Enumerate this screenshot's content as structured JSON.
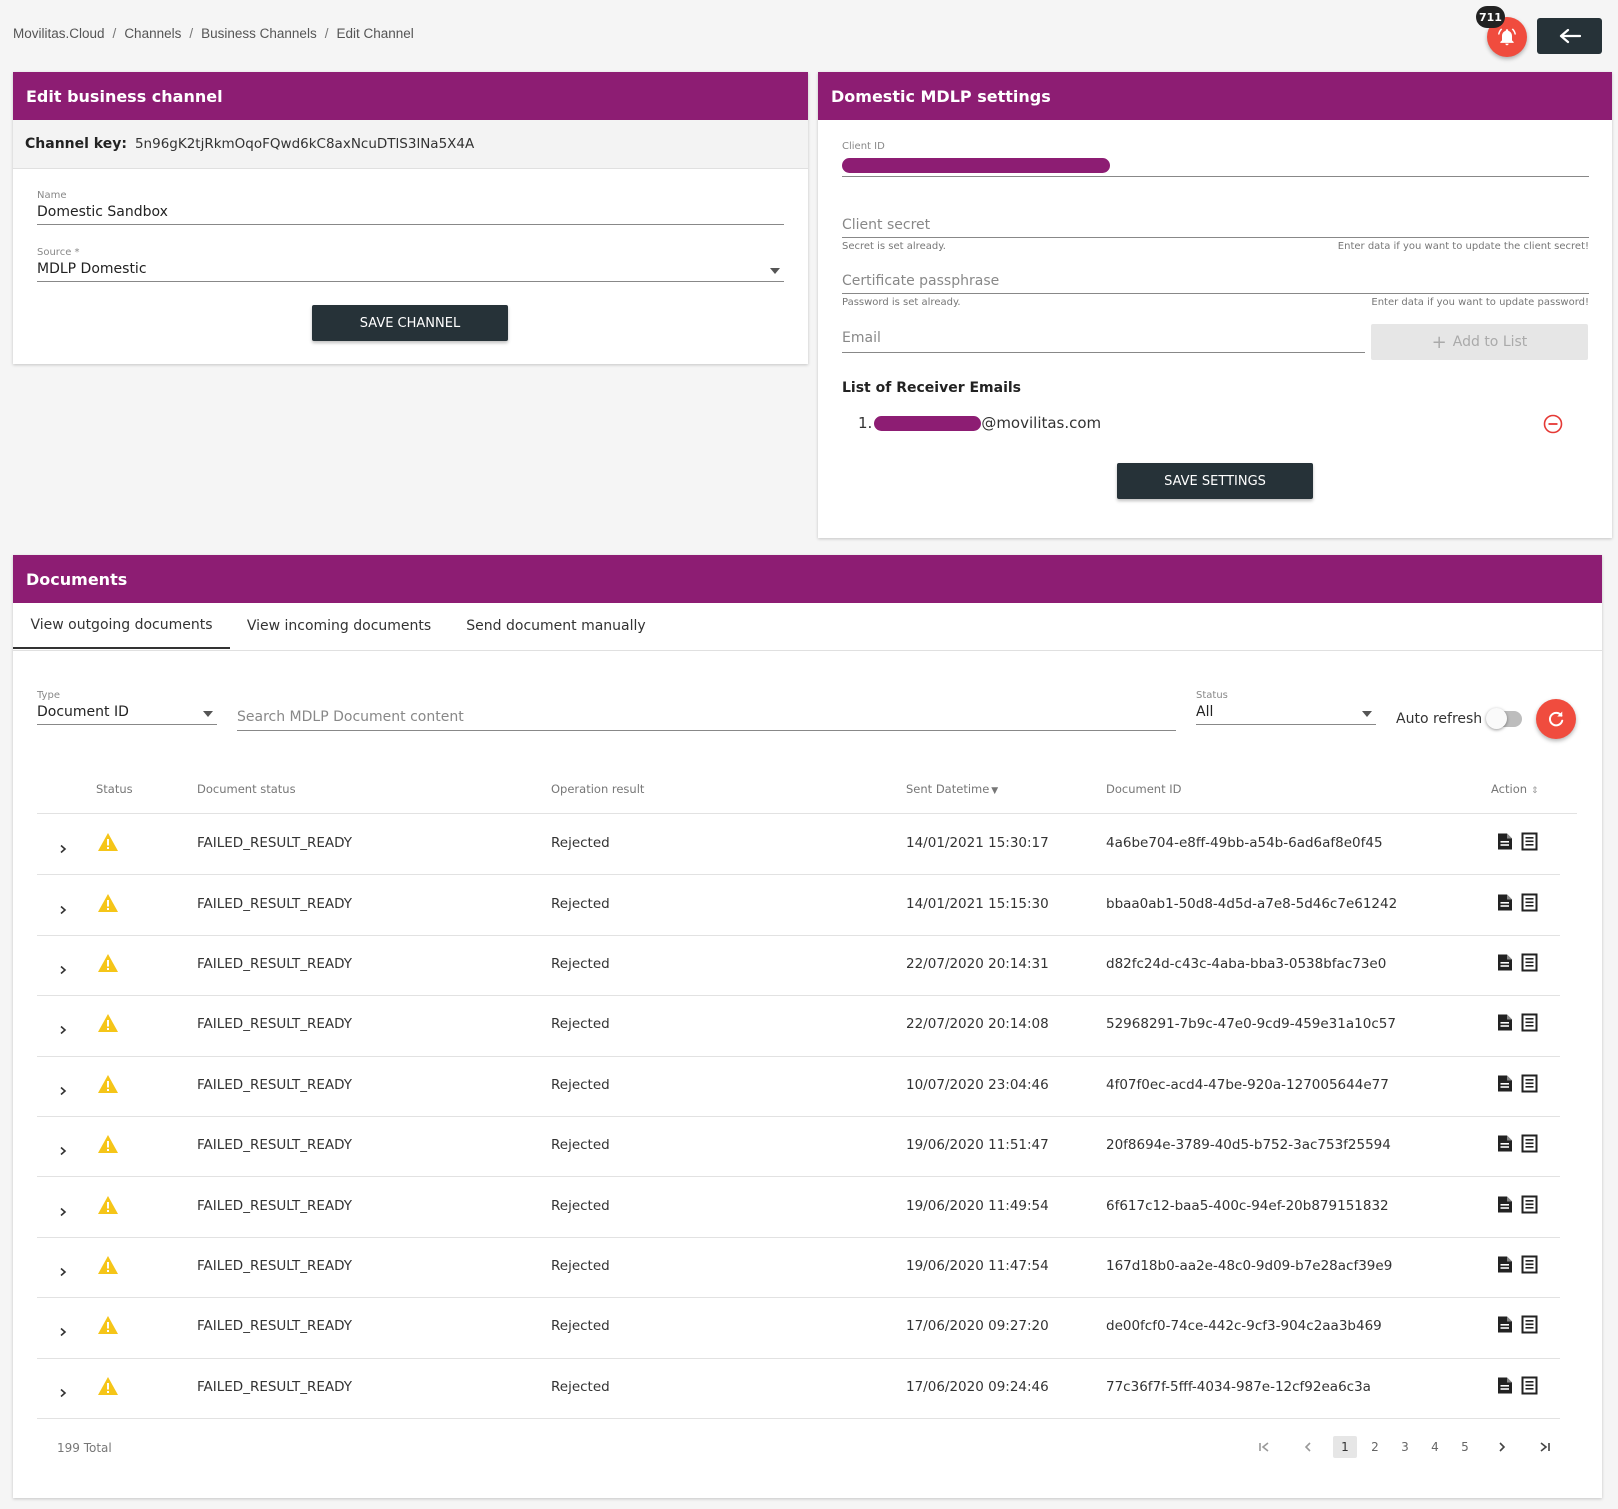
{
  "breadcrumb": [
    "Movilitas.Cloud",
    "Channels",
    "Business Channels",
    "Edit Channel"
  ],
  "notifications": {
    "count": "711"
  },
  "edit_channel": {
    "title": "Edit business channel",
    "channel_key_label": "Channel key:",
    "channel_key": "5n96gK2tjRkmOqoFQwd6kC8axNcuDTlS3lNa5X4A",
    "name_label": "Name",
    "name_value": "Domestic Sandbox",
    "source_label": "Source *",
    "source_value": "MDLP Domestic",
    "save_label": "SAVE CHANNEL"
  },
  "mdlp_settings": {
    "title": "Domestic MDLP settings",
    "client_id_label": "Client ID",
    "client_secret_placeholder": "Client secret",
    "secret_hint_left": "Secret is set already.",
    "secret_hint_right": "Enter data if you want to update the client secret!",
    "cert_placeholder": "Certificate passphrase",
    "cert_hint_left": "Password is set already.",
    "cert_hint_right": "Enter data if you want to update password!",
    "email_placeholder": "Email",
    "add_label": "Add to List",
    "receivers_title": "List of Receiver Emails",
    "receivers": [
      {
        "index": "1.",
        "domain": "@movilitas.com"
      }
    ],
    "save_label": "SAVE SETTINGS"
  },
  "documents": {
    "title": "Documents",
    "tabs": [
      "View outgoing documents",
      "View incoming documents",
      "Send document manually"
    ],
    "filters": {
      "type_label": "Type",
      "type_value": "Document ID",
      "search_placeholder": "Search MDLP Document content",
      "status_label": "Status",
      "status_value": "All",
      "auto_refresh_label": "Auto refresh"
    },
    "columns": [
      "Status",
      "Document status",
      "Operation result",
      "Sent Datetime",
      "Document ID",
      "Action"
    ],
    "rows": [
      {
        "doc_status": "FAILED_RESULT_READY",
        "result": "Rejected",
        "sent": "14/01/2021 15:30:17",
        "doc_id": "4a6be704-e8ff-49bb-a54b-6ad6af8e0f45"
      },
      {
        "doc_status": "FAILED_RESULT_READY",
        "result": "Rejected",
        "sent": "14/01/2021 15:15:30",
        "doc_id": "bbaa0ab1-50d8-4d5d-a7e8-5d46c7e61242"
      },
      {
        "doc_status": "FAILED_RESULT_READY",
        "result": "Rejected",
        "sent": "22/07/2020 20:14:31",
        "doc_id": "d82fc24d-c43c-4aba-bba3-0538bfac73e0"
      },
      {
        "doc_status": "FAILED_RESULT_READY",
        "result": "Rejected",
        "sent": "22/07/2020 20:14:08",
        "doc_id": "52968291-7b9c-47e0-9cd9-459e31a10c57"
      },
      {
        "doc_status": "FAILED_RESULT_READY",
        "result": "Rejected",
        "sent": "10/07/2020 23:04:46",
        "doc_id": "4f07f0ec-acd4-47be-920a-127005644e77"
      },
      {
        "doc_status": "FAILED_RESULT_READY",
        "result": "Rejected",
        "sent": "19/06/2020 11:51:47",
        "doc_id": "20f8694e-3789-40d5-b752-3ac753f25594"
      },
      {
        "doc_status": "FAILED_RESULT_READY",
        "result": "Rejected",
        "sent": "19/06/2020 11:49:54",
        "doc_id": "6f617c12-baa5-400c-94ef-20b879151832"
      },
      {
        "doc_status": "FAILED_RESULT_READY",
        "result": "Rejected",
        "sent": "19/06/2020 11:47:54",
        "doc_id": "167d18b0-aa2e-48c0-9d09-b7e28acf39e9"
      },
      {
        "doc_status": "FAILED_RESULT_READY",
        "result": "Rejected",
        "sent": "17/06/2020 09:27:20",
        "doc_id": "de00fcf0-74ce-442c-9cf3-904c2aa3b469"
      },
      {
        "doc_status": "FAILED_RESULT_READY",
        "result": "Rejected",
        "sent": "17/06/2020 09:24:46",
        "doc_id": "77c36f7f-5fff-4034-987e-12cf92ea6c3a"
      }
    ],
    "total": "199 Total",
    "pages": [
      "1",
      "2",
      "3",
      "4",
      "5"
    ]
  },
  "icons": {
    "bell": "bell-icon",
    "back": "arrow-left-icon",
    "dropdown": "caret-down-icon",
    "add": "plus-icon",
    "remove": "minus-circle-icon",
    "refresh": "refresh-icon",
    "warning": "warning-icon",
    "expand": "chevron-right-icon",
    "doc": "document-icon",
    "receipt": "receipt-icon"
  },
  "colors": {
    "brand": "#8d1d73",
    "dark_button": "#263238",
    "accent_red": "#f04c3e",
    "warning": "#f5c518"
  }
}
